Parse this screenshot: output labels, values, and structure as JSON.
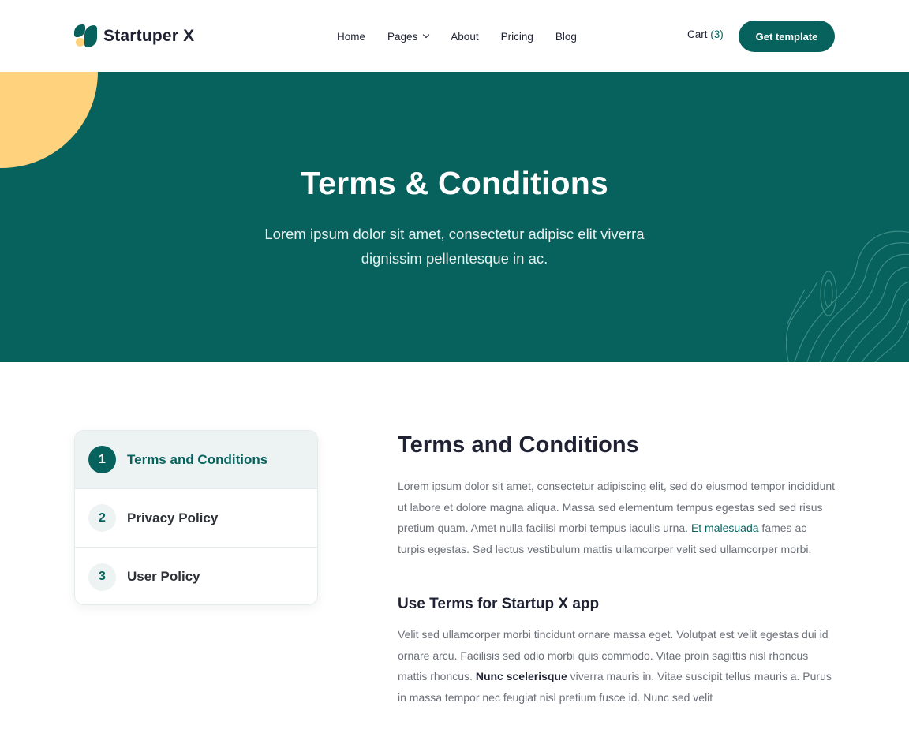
{
  "brand": {
    "name": "Startuper X",
    "colors": {
      "primary": "#07625d",
      "accent": "#ffd37d"
    }
  },
  "nav": {
    "items": [
      {
        "label": "Home"
      },
      {
        "label": "Pages",
        "has_dropdown": true
      },
      {
        "label": "About"
      },
      {
        "label": "Pricing"
      },
      {
        "label": "Blog"
      }
    ],
    "cart_label": "Cart",
    "cart_count": "(3)",
    "cta_label": "Get template"
  },
  "hero": {
    "title": "Terms & Conditions",
    "subtitle": "Lorem ipsum dolor sit amet, consectetur adipisc elit viverra dignissim pellentesque in ac."
  },
  "sidebar": {
    "items": [
      {
        "number": "1",
        "label": "Terms and Conditions",
        "active": true
      },
      {
        "number": "2",
        "label": "Privacy Policy",
        "active": false
      },
      {
        "number": "3",
        "label": "User Policy",
        "active": false
      }
    ]
  },
  "content": {
    "title": "Terms and Conditions",
    "para1_before_link": "Lorem ipsum dolor sit amet, consectetur adipiscing elit, sed do eiusmod tempor incididunt ut labore et dolore magna aliqua. Massa sed elementum tempus egestas sed sed risus pretium quam. Amet nulla facilisi morbi tempus iaculis urna. ",
    "para1_link": "Et malesuada",
    "para1_after_link": " fames ac turpis egestas. Sed lectus vestibulum mattis ullamcorper velit sed ullamcorper morbi.",
    "section_title": "Use Terms for Startup X app",
    "para2_before_bold": "Velit sed ullamcorper morbi tincidunt ornare massa eget. Volutpat est velit egestas dui id ornare arcu. Facilisis sed odio morbi quis commodo. Vitae proin sagittis nisl rhoncus mattis rhoncus. ",
    "para2_bold": "Nunc scelerisque",
    "para2_after_bold": " viverra mauris in. Vitae suscipit tellus mauris a. Purus in massa tempor nec feugiat nisl pretium fusce id. Nunc sed velit"
  }
}
